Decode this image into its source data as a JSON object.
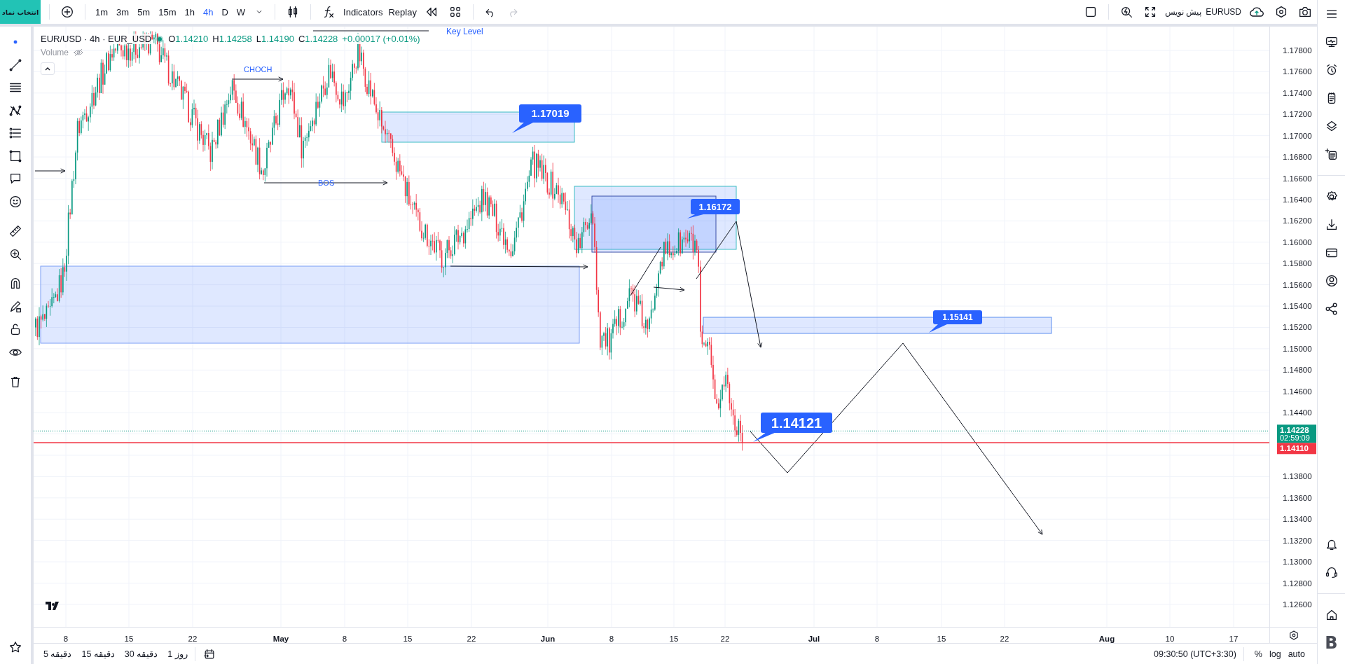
{
  "toolbar": {
    "symbol_button": "انتخاب نماد",
    "intervals": [
      {
        "label": "1m",
        "selected": false
      },
      {
        "label": "3m",
        "selected": false
      },
      {
        "label": "5m",
        "selected": false
      },
      {
        "label": "15m",
        "selected": false
      },
      {
        "label": "1h",
        "selected": false
      },
      {
        "label": "4h",
        "selected": true
      },
      {
        "label": "D",
        "selected": false
      },
      {
        "label": "W",
        "selected": false
      }
    ],
    "indicators": "Indicators",
    "replay": "Replay",
    "redo": {
      "disabled": true
    },
    "draft": "پیش نویس",
    "symbol": "EURUSD"
  },
  "legend": {
    "title": "EUR/USD · 4h · EUR_USD",
    "ohlc": [
      {
        "label": "O",
        "value": "1.14210"
      },
      {
        "label": "H",
        "value": "1.14258"
      },
      {
        "label": "L",
        "value": "1.14190"
      },
      {
        "label": "C",
        "value": "1.14228"
      }
    ],
    "change": "+0.00017 (+0.01%)",
    "volume": "Volume"
  },
  "chart": {
    "price_labels": [
      {
        "text": "1.17019"
      },
      {
        "text": "1.16172"
      },
      {
        "text": "1.15141"
      },
      {
        "text": "1.14121"
      }
    ],
    "text_labels": [
      {
        "text": "Key Level"
      },
      {
        "text": "CHOCH"
      },
      {
        "text": "BOS"
      }
    ]
  },
  "price_axis": {
    "ticks": [
      "1.17800",
      "1.17600",
      "1.17400",
      "1.17200",
      "1.17000",
      "1.16800",
      "1.16600",
      "1.16400",
      "1.16200",
      "1.16000",
      "1.15800",
      "1.15600",
      "1.15400",
      "1.15200",
      "1.15000",
      "1.14800",
      "1.14600",
      "1.14400",
      "1.13800",
      "1.13600",
      "1.13400",
      "1.13200",
      "1.13000",
      "1.12800",
      "1.12600"
    ],
    "last_price": "1.14228",
    "countdown": "02:59:09",
    "alert_price": "1.14110"
  },
  "time_axis": [
    {
      "text": "8",
      "kind": "day"
    },
    {
      "text": "15",
      "kind": "day"
    },
    {
      "text": "22",
      "kind": "day"
    },
    {
      "text": "May",
      "kind": "month"
    },
    {
      "text": "8",
      "kind": "day"
    },
    {
      "text": "15",
      "kind": "day"
    },
    {
      "text": "22",
      "kind": "day"
    },
    {
      "text": "Jun",
      "kind": "month"
    },
    {
      "text": "8",
      "kind": "day"
    },
    {
      "text": "15",
      "kind": "day"
    },
    {
      "text": "22",
      "kind": "day"
    },
    {
      "text": "Jul",
      "kind": "month"
    },
    {
      "text": "8",
      "kind": "day"
    },
    {
      "text": "15",
      "kind": "day"
    },
    {
      "text": "22",
      "kind": "day"
    },
    {
      "text": "Aug",
      "kind": "month"
    },
    {
      "text": "10",
      "kind": "day"
    },
    {
      "text": "17",
      "kind": "day"
    }
  ],
  "right_sidebar": {
    "badge": "B"
  },
  "bottom_bar": {
    "ranges": [
      "1 روز",
      "30 دقیقه",
      "15 دقیقه",
      "5 دقیقه"
    ],
    "time": "09:30:50 (UTC+3:30)",
    "options": [
      "%",
      "log",
      "auto"
    ]
  }
}
